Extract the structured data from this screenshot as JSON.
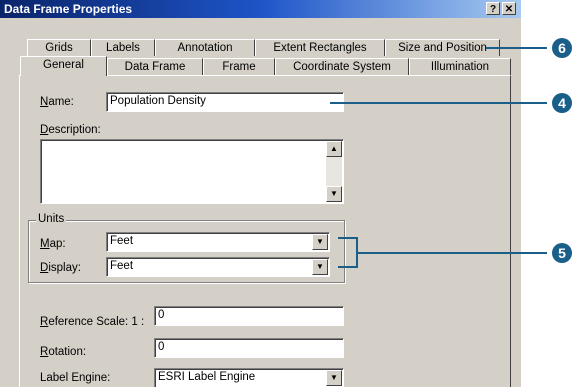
{
  "window": {
    "title": "Data Frame Properties",
    "help_btn": "?",
    "close_btn": "✕"
  },
  "tabs_back": [
    {
      "label": "Grids"
    },
    {
      "label": "Labels"
    },
    {
      "label": "Annotation"
    },
    {
      "label": "Extent Rectangles"
    },
    {
      "label": "Size and Position"
    }
  ],
  "tabs_front": [
    {
      "label": "General"
    },
    {
      "label": "Data Frame"
    },
    {
      "label": "Frame"
    },
    {
      "label": "Coordinate System"
    },
    {
      "label": "Illumination"
    }
  ],
  "general": {
    "name_label_u": "N",
    "name_label_rest": "ame:",
    "name_value": "Population Density",
    "description_label_u": "D",
    "description_label_rest": "escription:",
    "description_value": "",
    "units_group": "Units",
    "map_label_u": "M",
    "map_label_rest": "ap:",
    "map_value": "Feet",
    "display_label_u": "D",
    "display_label_rest": "isplay:",
    "display_value": "Feet",
    "refscale_label_u": "R",
    "refscale_label_rest": "eference Scale:  1 :",
    "refscale_value": "0",
    "rotation_label_u": "R",
    "rotation_label_rest": "otation:",
    "rotation_value": "0",
    "label_engine_label": "Label Engine:",
    "label_engine_value": "ESRI Label Engine"
  },
  "callouts": [
    "6",
    "4",
    "5"
  ]
}
